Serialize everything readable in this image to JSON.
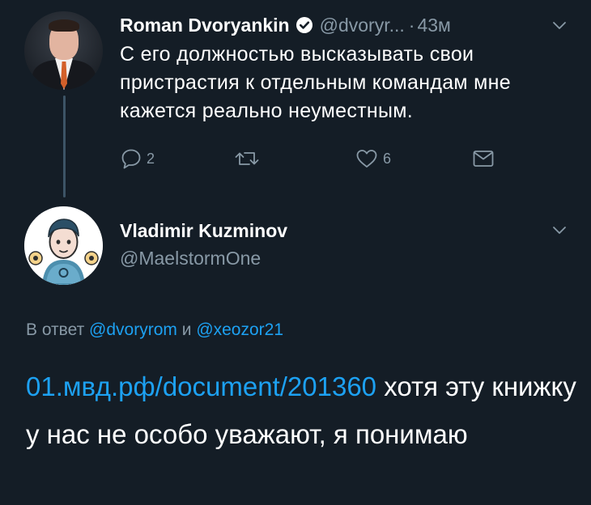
{
  "parent_tweet": {
    "author_name": "Roman Dvoryankin",
    "handle": "@dvoryr...",
    "separator": "·",
    "time": "43м",
    "text": "С его должностью высказывать свои пристрастия к отдельным командам мне кажется реально неуместным.",
    "actions": {
      "reply_count": "2",
      "retweet_count": "",
      "like_count": "6"
    }
  },
  "main_tweet": {
    "author_name": "Vladimir Kuzminov",
    "handle": "@MaelstormOne",
    "reply_prefix": "В ответ",
    "reply_mention_1": "@dvoryrom",
    "reply_conjunction": "и",
    "reply_mention_2": "@xeozor21",
    "link": "01.мвд.рф/document/201360",
    "text_after_link": "хотя эту книжку у нас не особо уважают, я понимаю"
  },
  "colors": {
    "background": "#141d26",
    "text": "#ffffff",
    "secondary": "#8899a6",
    "link": "#1da1f2",
    "thread_line": "#3d5466"
  },
  "icons": {
    "verified": "verified-badge-icon",
    "chevron": "chevron-down-icon",
    "reply": "reply-icon",
    "retweet": "retweet-icon",
    "like": "heart-icon",
    "dm": "envelope-icon"
  }
}
